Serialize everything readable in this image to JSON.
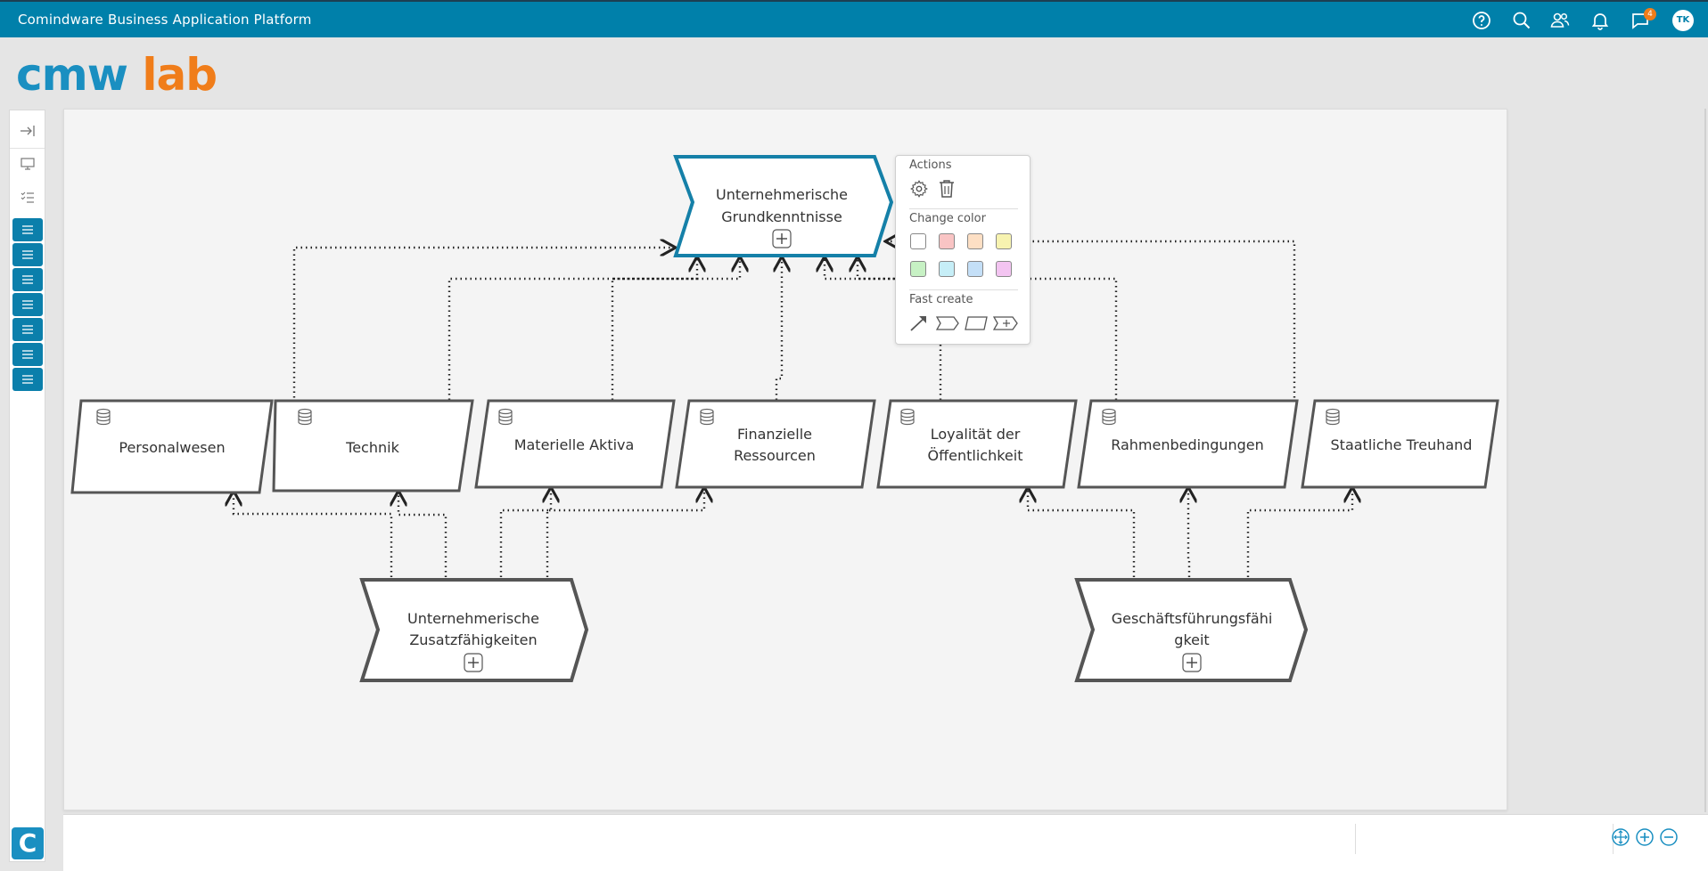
{
  "header": {
    "app_title": "Comindware Business Application Platform",
    "notification_count": "4",
    "user_initials": "TK",
    "icons": [
      "help-icon",
      "search-icon",
      "users-icon",
      "bell-icon",
      "chat-icon"
    ]
  },
  "logo": {
    "part1": "cmw",
    "part2": "lab",
    "color1": "#1a8fc1",
    "color2": "#f07d1a"
  },
  "colors": {
    "accent": "#0080aa",
    "selected_stroke": "#1580a8",
    "shape_stroke": "#555555"
  },
  "sidebar": {
    "icons": [
      "collapse-icon",
      "monitor-icon",
      "checklist-icon"
    ],
    "list_buttons": 7,
    "app_button": "C"
  },
  "diagram": {
    "selected": {
      "label_line1": "Unternehmerische",
      "label_line2": "Grundkenntnisse"
    },
    "resources": [
      {
        "line1": "Personalwesen",
        "line2": ""
      },
      {
        "line1": "Technik",
        "line2": ""
      },
      {
        "line1": "Materielle Aktiva",
        "line2": ""
      },
      {
        "line1": "Finanzielle",
        "line2": "Ressourcen"
      },
      {
        "line1": "Loyalität der",
        "line2": "Öffentlichkeit"
      },
      {
        "line1": "Rahmenbedingungen",
        "line2": ""
      },
      {
        "line1": "Staatliche Treuhand",
        "line2": ""
      }
    ],
    "left_process": {
      "line1": "Unternehmerische",
      "line2": "Zusatzfähigkeiten"
    },
    "right_process": {
      "line1": "Geschäftsführungsfähi",
      "line2": "gkeit"
    }
  },
  "popup": {
    "actions_label": "Actions",
    "change_color_label": "Change color",
    "fast_create_label": "Fast create",
    "action_icons": [
      "gear-icon",
      "trash-icon"
    ],
    "swatches": [
      "#ffffff",
      "#f9c4c4",
      "#fddfc4",
      "#f7f3b0",
      "#c7f1c4",
      "#c6eef7",
      "#c4dff7",
      "#f3c4f1"
    ],
    "fast_create_icons": [
      "arrow-icon",
      "event-shape-icon",
      "parallelogram-shape-icon",
      "process-shape-icon"
    ]
  },
  "zoom_icons": [
    "fit-icon",
    "zoom-in-icon",
    "zoom-out-icon"
  ]
}
